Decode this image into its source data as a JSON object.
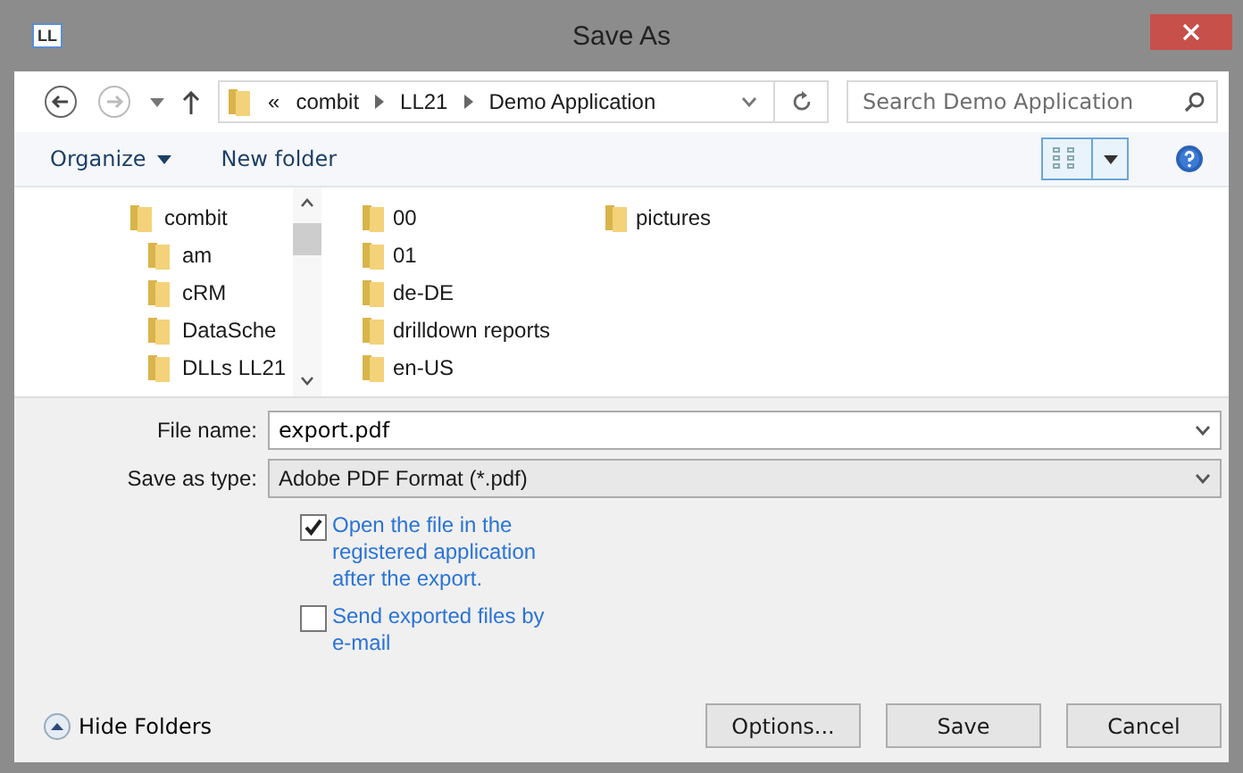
{
  "window": {
    "title": "Save As",
    "app_icon": "LL"
  },
  "address": {
    "overflow": "«",
    "segments": [
      "combit",
      "LL21",
      "Demo Application"
    ]
  },
  "search": {
    "placeholder": "Search Demo Application"
  },
  "toolbar": {
    "organize": "Organize",
    "new_folder": "New folder"
  },
  "tree": [
    {
      "label": "combit",
      "children": [
        {
          "label": "am"
        },
        {
          "label": "cRM"
        },
        {
          "label": "DataSche"
        },
        {
          "label": "DLLs LL21"
        }
      ]
    }
  ],
  "files": [
    {
      "name": "00"
    },
    {
      "name": "01"
    },
    {
      "name": "de-DE"
    },
    {
      "name": "drilldown reports"
    },
    {
      "name": "en-US"
    },
    {
      "name": "pictures"
    }
  ],
  "file_name": {
    "label": "File name:",
    "value": "export.pdf"
  },
  "save_type": {
    "label": "Save as type:",
    "value": "Adobe PDF Format (*.pdf)"
  },
  "options": [
    {
      "label": "Open the file in the registered application after the export.",
      "checked": true
    },
    {
      "label": "Send exported files by e-mail",
      "checked": false
    }
  ],
  "hide_folders": "Hide Folders",
  "buttons": [
    "Options...",
    "Save",
    "Cancel"
  ]
}
